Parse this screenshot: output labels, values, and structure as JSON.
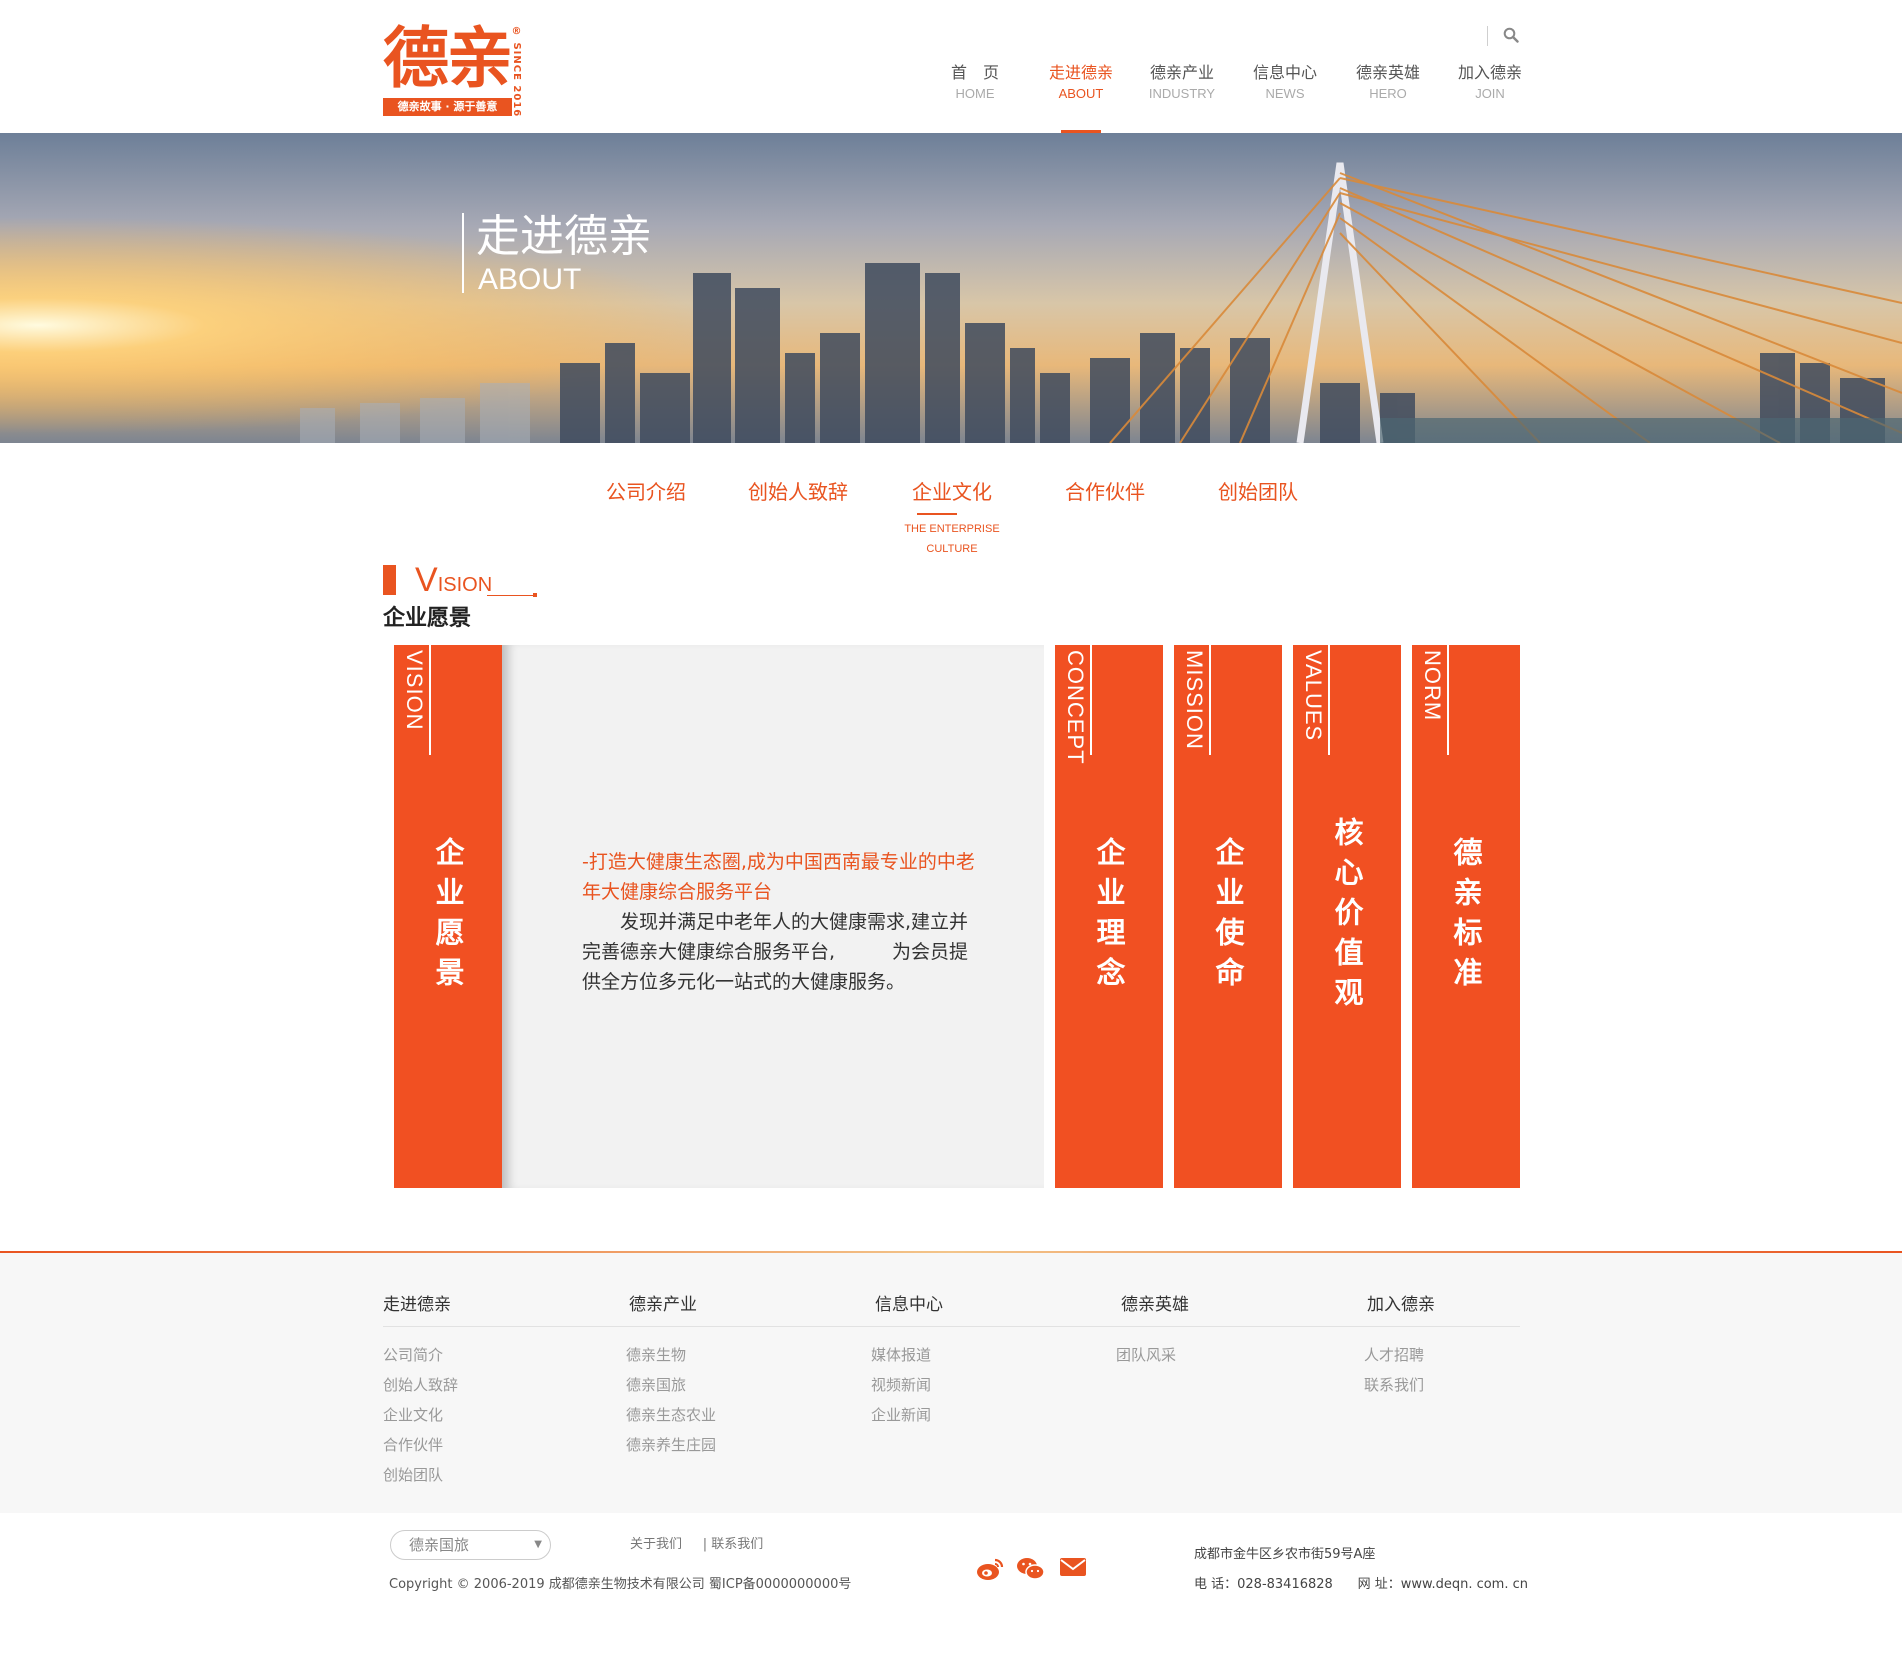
{
  "header": {
    "logo_text": "德亲",
    "logo_since": "SINCE 2016",
    "logo_registered": "®",
    "logo_slogan": "德亲故事 · 源于善意",
    "nav": [
      {
        "cn": "首　页",
        "en": "HOME",
        "active": false
      },
      {
        "cn": "走进德亲",
        "en": "ABOUT",
        "active": true
      },
      {
        "cn": "德亲产业",
        "en": "INDUSTRY",
        "active": false
      },
      {
        "cn": "信息中心",
        "en": "NEWS",
        "active": false
      },
      {
        "cn": "德亲英雄",
        "en": "HERO",
        "active": false
      },
      {
        "cn": "加入德亲",
        "en": "JOIN",
        "active": false
      }
    ]
  },
  "banner": {
    "title": "走进德亲",
    "subtitle": "ABOUT"
  },
  "subtabs": [
    {
      "cn": "公司介绍",
      "en": ""
    },
    {
      "cn": "创始人致辞",
      "en": ""
    },
    {
      "cn": "企业文化",
      "en": "THE ENTERPRISE CULTURE"
    },
    {
      "cn": "合作伙伴",
      "en": ""
    },
    {
      "cn": "创始团队",
      "en": ""
    }
  ],
  "section": {
    "en_big": "V",
    "en_rest": "ISION",
    "cn": "企业愿景"
  },
  "cards": [
    {
      "en": "VISION",
      "cn": "企业愿景"
    },
    {
      "en": "CONCEPT",
      "cn": "企业理念"
    },
    {
      "en": "MISSION",
      "cn": "企业使命"
    },
    {
      "en": "VALUES",
      "cn": "核心价值观"
    },
    {
      "en": "NORM",
      "cn": "德亲标准"
    }
  ],
  "vision": {
    "title": "-打造大健康生态圈,成为中国西南最专业的中老年大健康综合服务平台",
    "body": "发现并满足中老年人的大健康需求,建立并完善德亲大健康综合服务平台,　　　为会员提供全方位多元化一站式的大健康服务。"
  },
  "footer": {
    "columns": [
      {
        "head": "走进德亲",
        "links": [
          "公司简介",
          "创始人致辞",
          "企业文化",
          "合作伙伴",
          "创始团队"
        ]
      },
      {
        "head": "德亲产业",
        "links": [
          "德亲生物",
          "德亲国旅",
          "德亲生态农业",
          "德亲养生庄园"
        ]
      },
      {
        "head": "信息中心",
        "links": [
          "媒体报道",
          "视频新闻",
          "企业新闻"
        ]
      },
      {
        "head": "德亲英雄",
        "links": [
          "团队风采"
        ]
      },
      {
        "head": "加入德亲",
        "links": [
          "人才招聘",
          "联系我们"
        ]
      }
    ],
    "select_value": "德亲国旅",
    "link_about": "关于我们",
    "link_contact": "| 联系我们",
    "copyright": "Copyright © 2006-2019 成都德亲生物技术有限公司  蜀ICP备0000000000号",
    "address": "成都市金牛区乡农市街59号A座",
    "phone": "电  话：028-83416828",
    "website": "网  址：www.deqn. com. cn"
  },
  "colors": {
    "accent": "#e95420",
    "card": "#f15022"
  },
  "icons": [
    "search-icon",
    "weibo-icon",
    "wechat-icon",
    "mail-icon"
  ]
}
